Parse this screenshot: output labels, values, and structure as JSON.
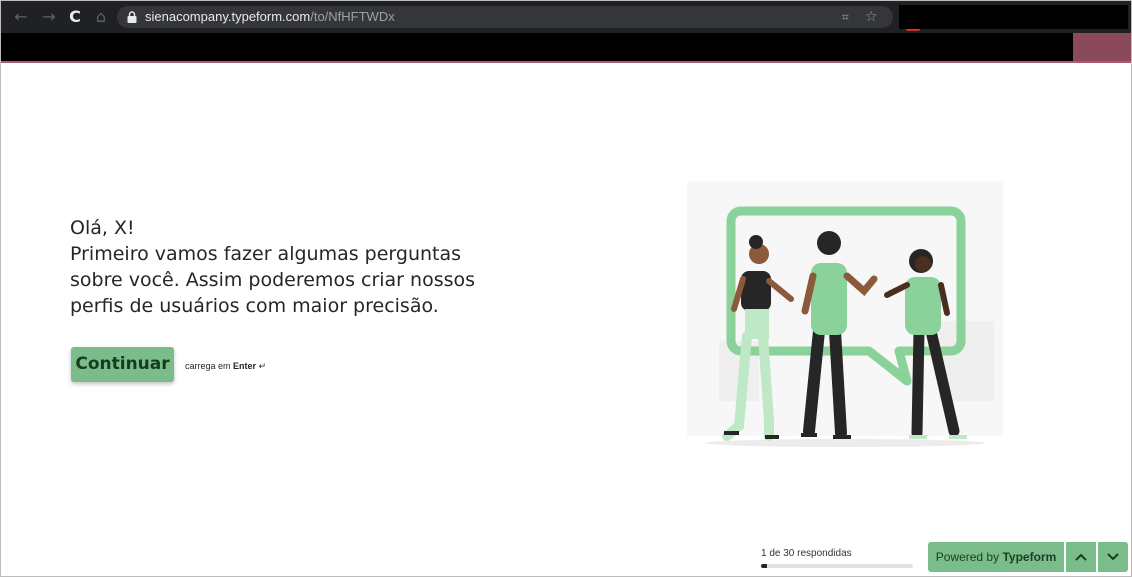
{
  "browser": {
    "url_host": "sienacompany.typeform.com",
    "url_path": "/to/NfHFTWDx",
    "icons": [
      "back-icon",
      "forward-icon",
      "reload-icon",
      "home-icon",
      "lock-icon",
      "qr-code-icon",
      "star-icon"
    ],
    "back_glyph": "←",
    "forward_glyph": "→",
    "reload_glyph": "C",
    "home_glyph": "⌂",
    "qr_glyph": "⌗",
    "star_glyph": "☆"
  },
  "form": {
    "greeting": "Olá, X!",
    "question": "Primeiro vamos fazer algumas perguntas sobre você. Assim poderemos criar nossos perfis de usuários com maior precisão.",
    "continue_label": "Continuar",
    "hint_prefix": "carrega em",
    "hint_key": "Enter",
    "hint_glyph": "↵"
  },
  "footer": {
    "progress_text": "1 de 30 respondidas",
    "progress_fraction": 0.04,
    "powered_prefix": "Powered by",
    "powered_brand": "Typeform",
    "up_icon": "chevron-up-icon",
    "down_icon": "chevron-down-icon"
  },
  "colors": {
    "accent": "#7bbd8a",
    "browser_bar": "#202124",
    "tab_accent": "#b05a6f"
  }
}
